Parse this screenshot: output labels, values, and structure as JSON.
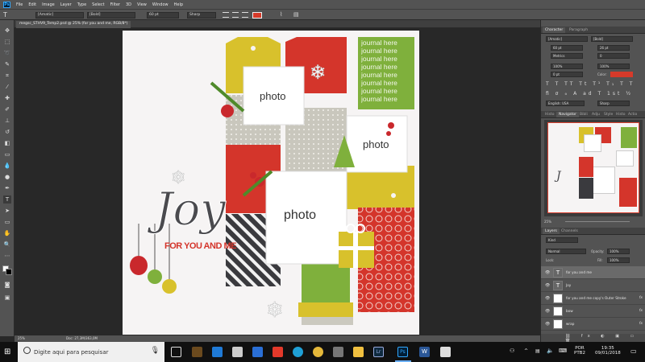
{
  "menu": [
    "File",
    "Edit",
    "Image",
    "Layer",
    "Type",
    "Select",
    "Filter",
    "3D",
    "View",
    "Window",
    "Help"
  ],
  "app_logo": "Ps",
  "options": {
    "font_family": "[Amatic]",
    "font_style": "[Bold]",
    "font_size": "60 pt",
    "antialias": "Sharp"
  },
  "doc_tab": "megsc_STHV9_Temp2.psd @ 25% (for you and me, RGB/8*)",
  "status": {
    "zoom": "25%",
    "doc": "Doc: 27,3M/363,0M"
  },
  "canvas": {
    "photo_labels": [
      "photo",
      "photo",
      "photo"
    ],
    "journal_text": "journal here journal here journal here journal here journal here journal here journal here journal here",
    "joy_title": "Joy",
    "joy_subtitle": "FOR YOU AND ME"
  },
  "character_panel": {
    "tabs": [
      "Character",
      "Paragraph"
    ],
    "font_family": "[Amatic]",
    "font_style": "[Bold]",
    "size": "60 pt",
    "leading": "26 pt",
    "kerning": "Metrics",
    "tracking": "0",
    "scale_v": "100%",
    "scale_h": "100%",
    "baseline": "0 pt",
    "color_label": "Color:",
    "language": "English: USA",
    "aa": "Sharp",
    "text_color": "#d63a2a"
  },
  "navigator_panel": {
    "tabs": [
      "Histo",
      "Navigator",
      "Bibli",
      "Adju",
      "Style",
      "Histo",
      "Actio"
    ],
    "zoom": "25%"
  },
  "layers_panel": {
    "tabs": [
      "Layers",
      "Channels"
    ],
    "filter": "Kind",
    "blend": "Normal",
    "opacity_label": "Opacity:",
    "opacity": "100%",
    "lock_label": "Lock:",
    "fill_label": "Fill:",
    "fill": "100%",
    "layers": [
      {
        "name": "for you and me",
        "type": "text",
        "fx": false,
        "selected": true
      },
      {
        "name": "Joy",
        "type": "text",
        "fx": false,
        "selected": false
      },
      {
        "name": "for you and me copy's Outer Stroke",
        "type": "img",
        "fx": true,
        "selected": false
      },
      {
        "name": "bow",
        "type": "img",
        "fx": true,
        "selected": false
      },
      {
        "name": "wrap",
        "type": "img",
        "fx": true,
        "selected": false
      }
    ]
  },
  "taskbar": {
    "search_placeholder": "Digite aqui para pesquisar",
    "lang": "POR",
    "kbd": "PTB2",
    "time": "19:35",
    "date": "09/01/2018"
  }
}
